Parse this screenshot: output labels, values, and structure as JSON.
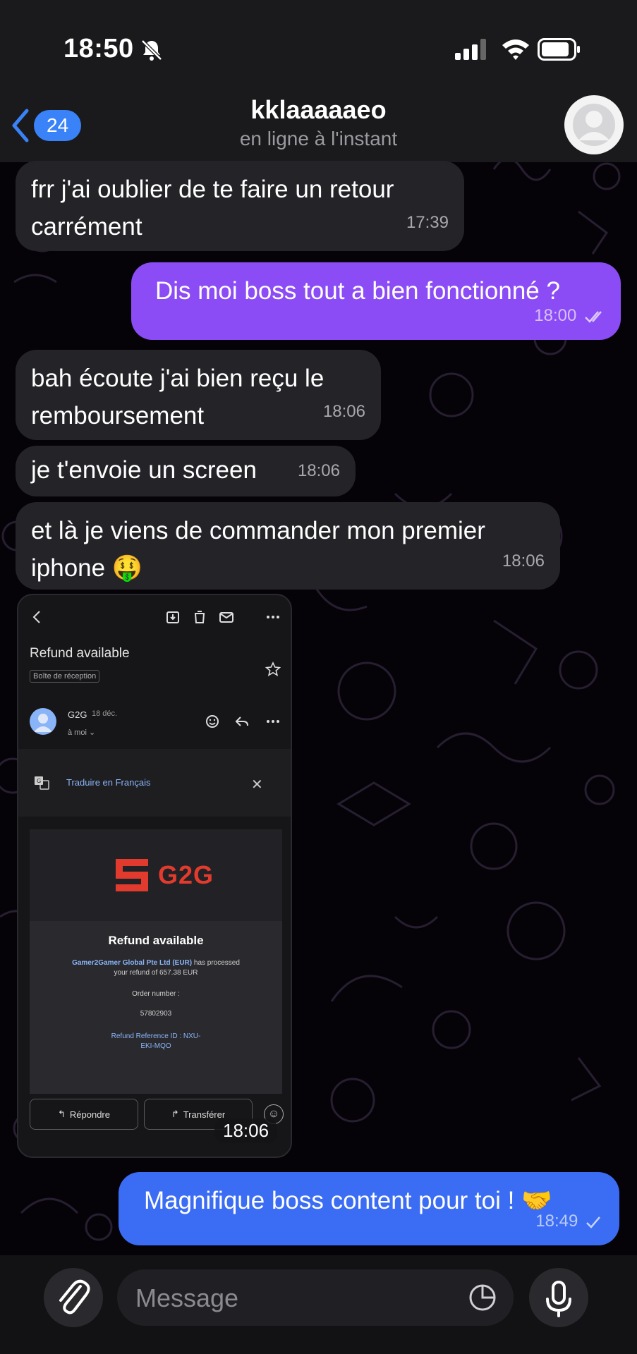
{
  "status_bar": {
    "time": "18:50"
  },
  "header": {
    "back_count": "24",
    "name": "kklaaaaaeo",
    "status": "en ligne à l'instant"
  },
  "messages": [
    {
      "direction": "in",
      "text_line1": "frr j'ai oublier de te faire un retour",
      "text_line2": "carrément",
      "time": "17:39"
    },
    {
      "direction": "out",
      "text_line1": "Dis moi boss tout a bien fonctionné ?",
      "time": "18:00",
      "status": "read"
    },
    {
      "direction": "in",
      "text_line1": "bah écoute j'ai bien reçu le",
      "text_line2": "remboursement",
      "time": "18:06"
    },
    {
      "direction": "in",
      "text_line1": "je t'envoie un screen",
      "time": "18:06"
    },
    {
      "direction": "in",
      "text_line1": "et là je viens de commander mon premier",
      "text_line2": "iphone 🤑",
      "time": "18:06"
    },
    {
      "direction": "out",
      "text_line1": "Magnifique boss content pour toi ! 🤝",
      "time": "18:49",
      "status": "sent"
    }
  ],
  "image_message": {
    "time": "18:06",
    "email": {
      "subject": "Refund available",
      "folder": "Boîte de réception",
      "sender": "G2G",
      "date": "18 déc.",
      "to": "à moi ⌄",
      "translate": "Traduire en Français",
      "brand": "G2G",
      "title": "Refund available",
      "line1_company": "Gamer2Gamer Global Pte Ltd (EUR)",
      "line1_rest": " has processed",
      "line2": "your refund of 657.38 EUR",
      "order_label": "Order number :",
      "order_number": "57802903",
      "ref_label": "Refund Reference ID : NXU-",
      "ref_value": "EKI-MQO",
      "reply": "Répondre",
      "forward": "Transférer"
    }
  },
  "input": {
    "placeholder": "Message"
  },
  "colors": {
    "incoming_bubble": "#242328",
    "outgoing_bubble": "#8b4cf5",
    "outgoing_bubble_last": "#3b6cf4",
    "accent": "#3a82f7",
    "brand_red": "#e23b2e"
  }
}
